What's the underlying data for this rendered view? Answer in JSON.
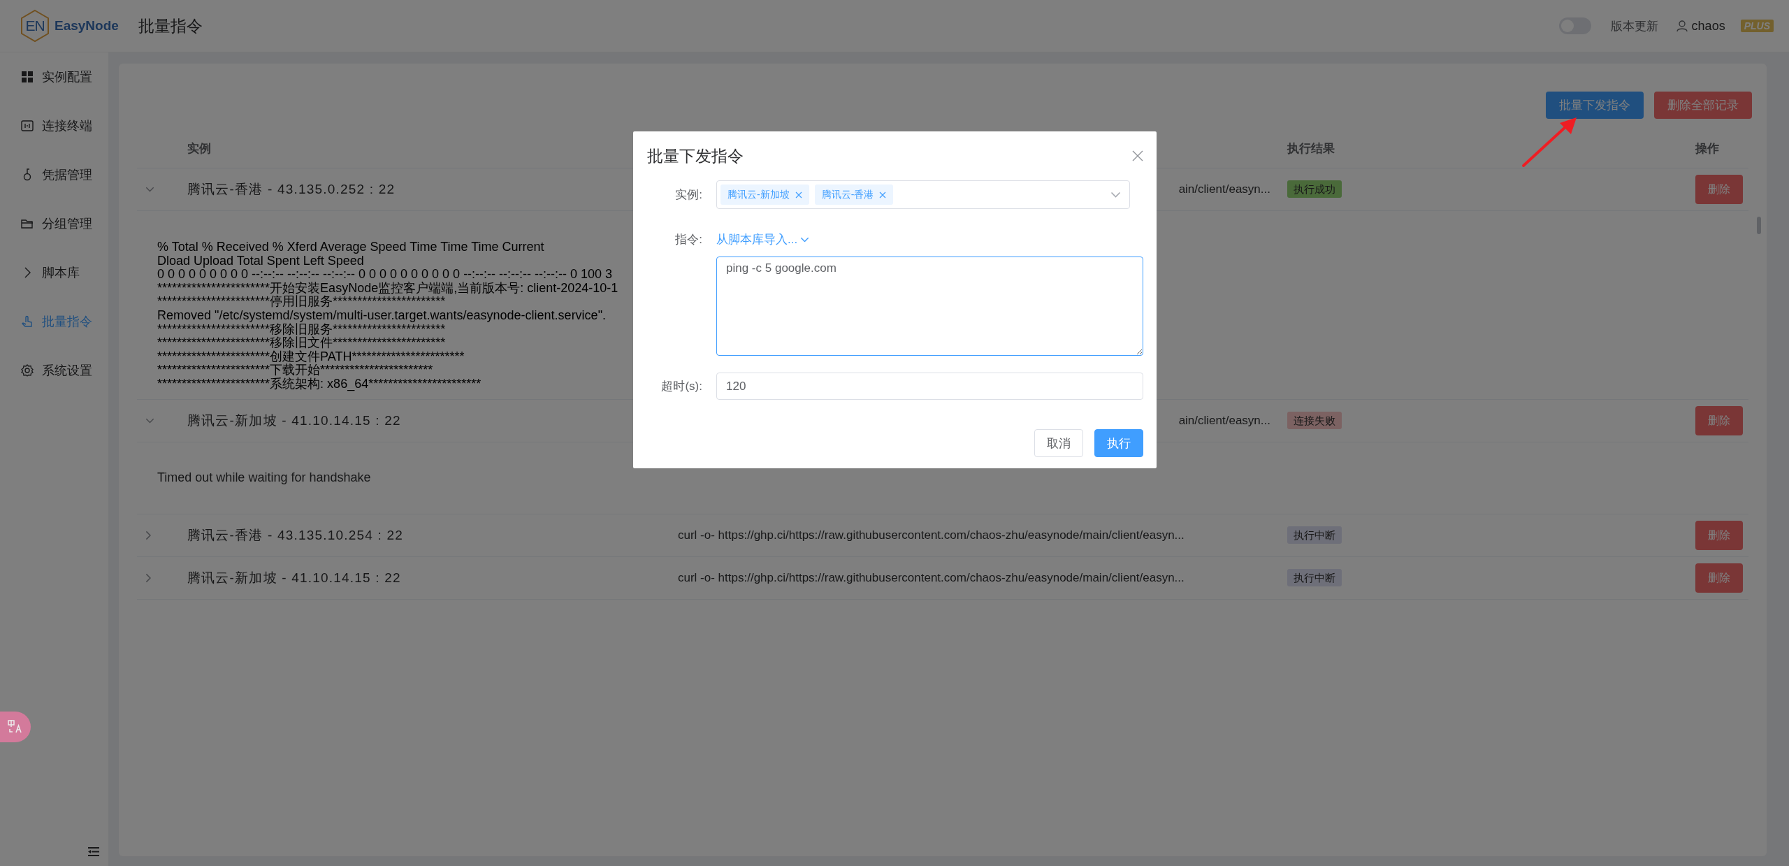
{
  "app": {
    "logo_mark": "EN",
    "name": "EasyNode"
  },
  "header": {
    "title": "批量指令",
    "theme_toggle": {
      "on": false
    },
    "update_link": "版本更新",
    "user": "chaos",
    "badge": "PLUS"
  },
  "sidebar": {
    "items": [
      {
        "label": "实例配置",
        "selected": false
      },
      {
        "label": "连接终端",
        "selected": false
      },
      {
        "label": "凭据管理",
        "selected": false
      },
      {
        "label": "分组管理",
        "selected": false
      },
      {
        "label": "脚本库",
        "selected": false
      },
      {
        "label": "批量指令",
        "selected": true
      },
      {
        "label": "系统设置",
        "selected": false
      }
    ]
  },
  "toolbar": {
    "buttons": [
      {
        "label": "批量下发指令",
        "kind": "primary"
      },
      {
        "label": "删除全部记录",
        "kind": "danger"
      }
    ]
  },
  "table": {
    "columns": [
      {
        "label": "实例"
      },
      {
        "label": "执行结果"
      },
      {
        "label": "操作"
      }
    ],
    "rows": [
      {
        "expanded": true,
        "instance": "腾讯云-香港 - 43.135.0.252 : 22",
        "command": "ain/client/easyn...",
        "command_cut": true,
        "result": "执行成功",
        "color": "#4a6a3a",
        "action": "删除",
        "log": [
          "% Total % Received % Xferd Average Speed Time Time Time Current",
          "Dload Upload Total Spent Left Speed",
          "0 0 0 0 0 0 0 0 0 --:--:-- --:--:-- --:--:-- 0 0 0 0 0 0 0 0 0 0 --:--:-- --:--:-- --:--:-- 0 100 3",
          "***********************开始安装EasyNode监控客户端端,当前版本号: client-2024-10-1",
          "***********************停用旧服务***********************",
          "Removed \"/etc/systemd/system/multi-user.target.wants/easynode-client.service\".",
          "***********************移除旧服务***********************",
          "***********************移除旧文件***********************",
          "***********************创建文件PATH***********************",
          "***********************下载开始***********************",
          "***********************系统架构: x86_64***********************"
        ]
      },
      {
        "expanded": true,
        "instance": "腾讯云-新加坡 - 41.10.14.15 : 22",
        "command": "ain/client/easyn...",
        "command_cut": true,
        "result": "连接失败",
        "color": "#7c6262",
        "action": "删除",
        "log": [
          "Timed out while waiting for handshake"
        ]
      },
      {
        "expanded": false,
        "instance": "腾讯云-香港 - 43.135.10.254 : 22",
        "command": "curl -o- https://ghp.ci/https://raw.githubusercontent.com/chaos-zhu/easynode/main/client/easyn...",
        "command_cut": false,
        "result": "执行中断",
        "color": "#6e6f79",
        "action": "删除"
      },
      {
        "expanded": false,
        "instance": "腾讯云-新加坡 - 41.10.14.15 : 22",
        "command": "curl -o- https://ghp.ci/https://raw.githubusercontent.com/chaos-zhu/easynode/main/client/easyn...",
        "command_cut": false,
        "result": "执行中断",
        "color": "#6e6f79",
        "action": "删除"
      }
    ]
  },
  "dialog": {
    "title": "批量下发指令",
    "instance_label": "实例:",
    "selected_instances": [
      "腾讯云-新加坡",
      "腾讯云-香港"
    ],
    "command_label": "指令:",
    "import_link": "从脚本库导入...",
    "command_value": "ping -c 5 google.com",
    "timeout_label": "超时(s):",
    "timeout_value": "120",
    "buttons": [
      {
        "label": "取消",
        "kind": "default"
      },
      {
        "label": "执行",
        "kind": "primary"
      }
    ]
  }
}
